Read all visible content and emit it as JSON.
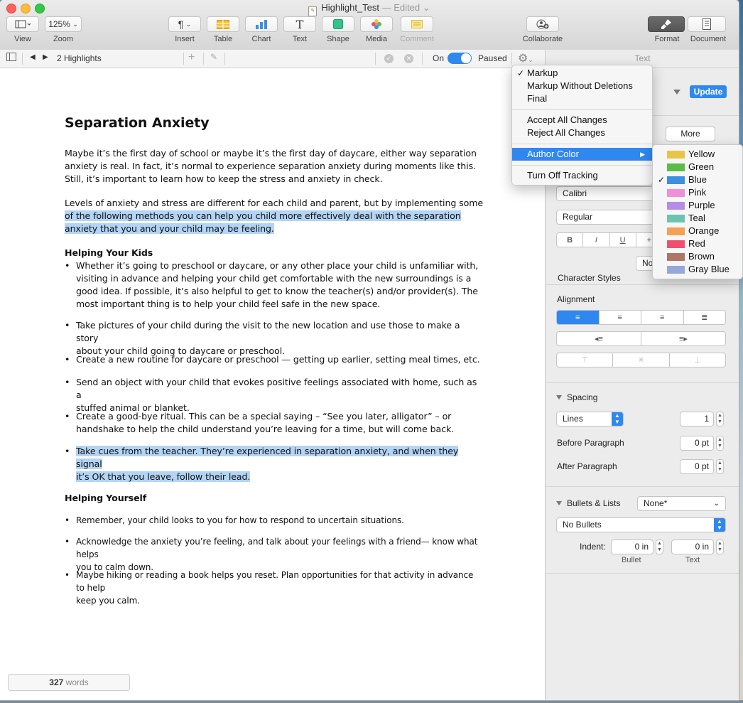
{
  "window": {
    "title": "Highlight_Test",
    "status": "— Edited",
    "doc_icon": "pages-doc-icon"
  },
  "toolbar": {
    "view_label": "View",
    "zoom_value": "125%",
    "zoom_label": "Zoom",
    "insert_label": "Insert",
    "table_label": "Table",
    "chart_label": "Chart",
    "text_label": "Text",
    "shape_label": "Shape",
    "media_label": "Media",
    "comment_label": "Comment",
    "collaborate_label": "Collaborate",
    "format_label": "Format",
    "document_label": "Document"
  },
  "tracking_bar": {
    "highlights": "2 Highlights",
    "on_label": "On",
    "paused_label": "Paused"
  },
  "document": {
    "title": "Separation Anxiety",
    "paragraph1": [
      "Maybe it’s the first day of school or maybe it’s the first day of daycare, either way separation",
      "anxiety is real. In fact, it’s normal to experience separation anxiety during moments like this.",
      "Still, it’s important to learn how to keep the stress and anxiety in check."
    ],
    "paragraph2": [
      "Levels of anxiety and stress are different for each child and parent, but by implementing some",
      "of the following methods you can help you child more effectively deal with the separation",
      "anxiety that you and your child may be feeling."
    ],
    "heading_kids": "Helping Your Kids",
    "kids_bullets": [
      [
        "Whether it’s going to preschool or daycare, or any other place your child is unfamiliar with,",
        "visiting in advance and helping your child get comfortable with the new surroundings is a",
        "good idea. If possible, it’s also helpful to get to know the teacher(s) and/or provider(s). The",
        "most important thing is to help your child feel safe in the new space."
      ],
      [
        "Take pictures of your child during the visit to the new location and use  those to make a story",
        "about your child going to daycare or preschool."
      ],
      [
        "Create a new routine for daycare or preschool — getting up earlier, setting meal times, etc."
      ],
      [
        "Send an object with your child that evokes positive feelings associated with home, such as a",
        "stuffed animal or blanket."
      ],
      [
        "Create a good-bye ritual. This can be a special saying – “See you later, alligator” – or",
        "handshake to help the child understand you’re leaving for a time, but will come back."
      ],
      [
        "Take cues from the teacher. They’re experienced in separation anxiety, and when they signal",
        "it’s OK that you leave, follow their lead."
      ]
    ],
    "heading_yourself": "Helping Yourself",
    "yourself_bullets": [
      [
        "Remember, your child looks to you for how to respond to uncertain situations."
      ],
      [
        "Acknowledge the anxiety you’re feeling, and talk about your feelings with a friend— know what helps",
        "you to calm down."
      ],
      [
        "Maybe hiking or reading a book helps you reset. Plan opportunities for that activity in advance to help",
        "keep you calm."
      ]
    ],
    "word_count": "327",
    "word_count_label": "words"
  },
  "inspector": {
    "header": "Text",
    "update_label": "Update",
    "more_label": "More",
    "font_family": "Calibri",
    "font_style": "Regular",
    "bold": "B",
    "italic": "I",
    "underline": "U",
    "character_styles_label": "Character Styles",
    "character_styles_value": "No",
    "alignment_label": "Alignment",
    "spacing_label": "Spacing",
    "spacing_mode": "Lines",
    "spacing_value": "1",
    "before_paragraph_label": "Before Paragraph",
    "before_paragraph_value": "0 pt",
    "after_paragraph_label": "After Paragraph",
    "after_paragraph_value": "0 pt",
    "bullets_lists_label": "Bullets & Lists",
    "bullets_lists_value": "None*",
    "bullet_type": "No Bullets",
    "indent_label": "Indent:",
    "bullet_indent": "0 in",
    "text_indent": "0 in",
    "bullet_sublabel": "Bullet",
    "text_sublabel": "Text"
  },
  "tracking_menu": {
    "items": [
      "Markup",
      "Markup Without Deletions",
      "Final"
    ],
    "checked": "Markup",
    "actions": [
      "Accept All Changes",
      "Reject All Changes"
    ],
    "author_color": "Author Color",
    "turn_off": "Turn Off Tracking"
  },
  "color_menu": {
    "checked": "Blue",
    "colors": [
      {
        "name": "Yellow",
        "hex": "#e8c547"
      },
      {
        "name": "Green",
        "hex": "#5bbd47"
      },
      {
        "name": "Blue",
        "hex": "#3d8fe0"
      },
      {
        "name": "Pink",
        "hex": "#f08fd8"
      },
      {
        "name": "Purple",
        "hex": "#b48ee6"
      },
      {
        "name": "Teal",
        "hex": "#6cc3b4"
      },
      {
        "name": "Orange",
        "hex": "#f4a157"
      },
      {
        "name": "Red",
        "hex": "#f0506e"
      },
      {
        "name": "Brown",
        "hex": "#b07565"
      },
      {
        "name": "Gray Blue",
        "hex": "#96a8d8"
      }
    ]
  },
  "colors": {
    "accent": "#2f87f0",
    "highlight": "#b3d4f5"
  }
}
